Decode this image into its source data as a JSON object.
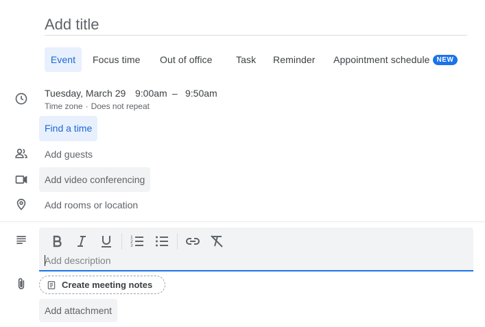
{
  "title": {
    "placeholder": "Add title"
  },
  "tabs": [
    {
      "label": "Event",
      "active": true
    },
    {
      "label": "Focus time"
    },
    {
      "label": "Out of office"
    },
    {
      "label": "Task"
    },
    {
      "label": "Reminder"
    },
    {
      "label": "Appointment schedule",
      "badge": "NEW"
    }
  ],
  "datetime": {
    "date": "Tuesday, March 29",
    "start": "9:00am",
    "dash": "–",
    "end": "9:50am",
    "timezone": "Time zone",
    "separator": "·",
    "repeat": "Does not repeat"
  },
  "find_time": "Find a time",
  "guests": "Add guests",
  "video": "Add video conferencing",
  "location": "Add rooms or location",
  "description": {
    "placeholder": "Add description",
    "toolbar": [
      "bold-icon",
      "italic-icon",
      "underline-icon",
      "numbered-list-icon",
      "bulleted-list-icon",
      "link-icon",
      "clear-formatting-icon"
    ]
  },
  "notes_chip": "Create meeting notes",
  "attachment": "Add attachment",
  "colors": {
    "accent": "#1a73e8",
    "active_bg": "#e8f0fe",
    "active_text": "#1967d2",
    "button_bg": "#f1f3f4"
  },
  "icons": [
    "clock-icon",
    "people-icon",
    "video-camera-icon",
    "location-pin-icon",
    "notes-lines-icon",
    "paperclip-icon",
    "document-icon"
  ]
}
